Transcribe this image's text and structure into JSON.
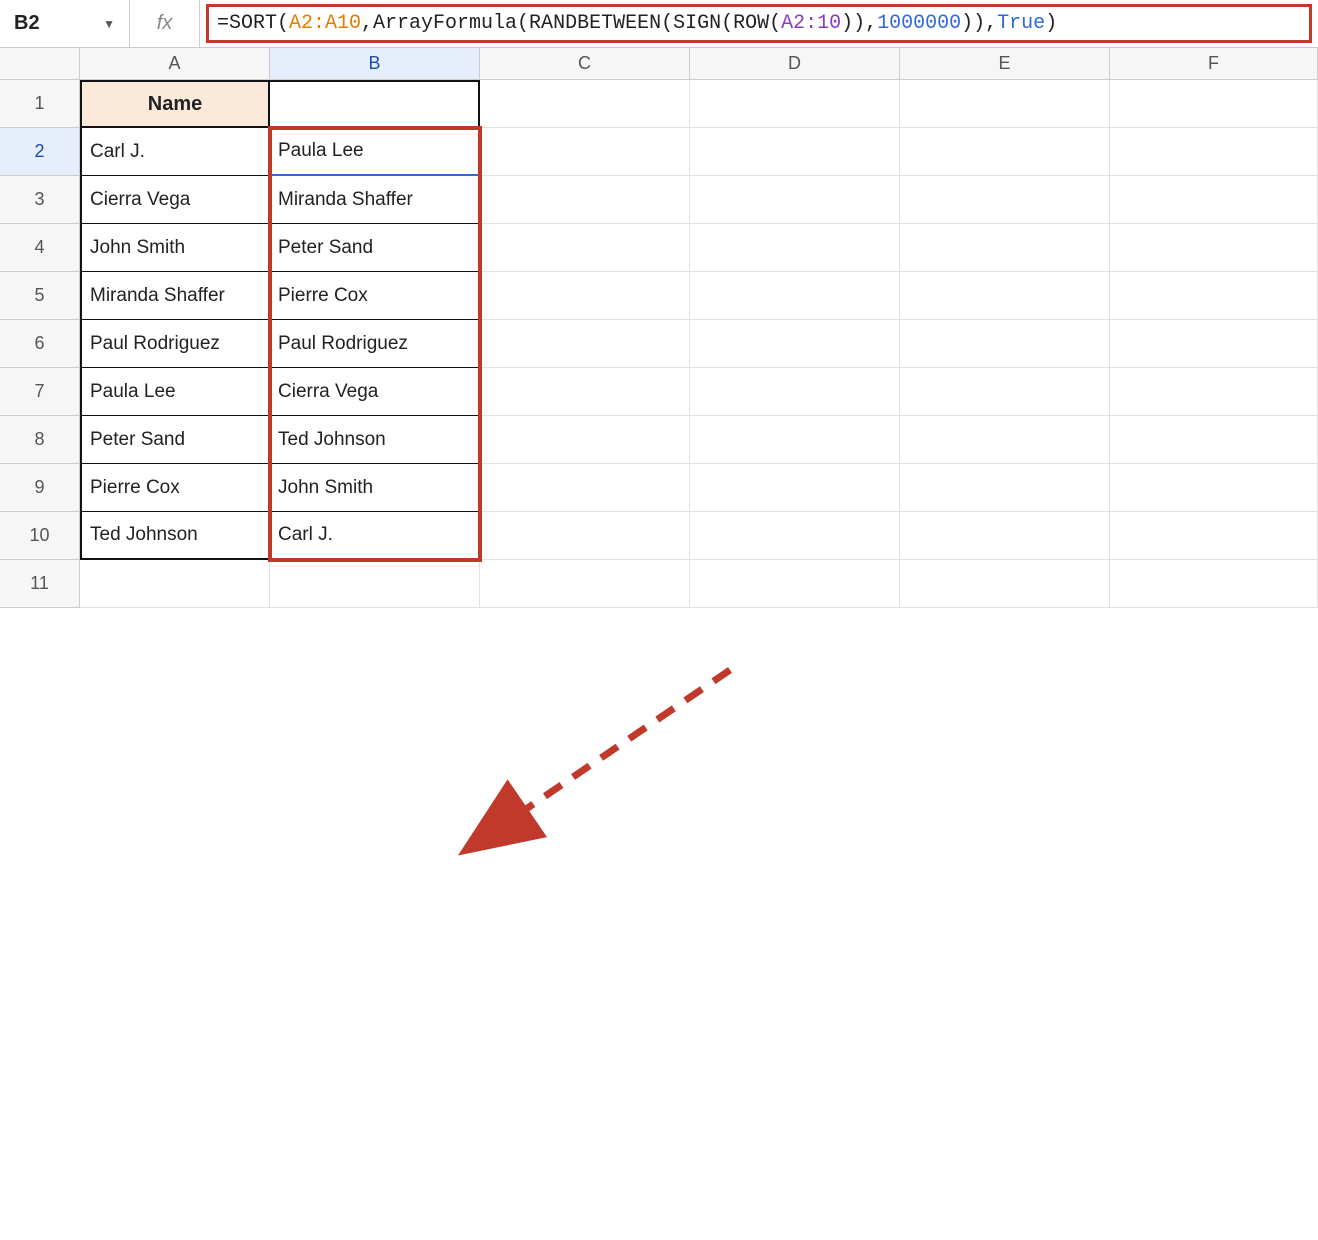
{
  "nameBox": {
    "cellRef": "B2"
  },
  "fxLabel": "fx",
  "formula": {
    "parts": [
      {
        "cls": "tok-black",
        "text": "=SORT("
      },
      {
        "cls": "tok-orange",
        "text": "A2:A10"
      },
      {
        "cls": "tok-black",
        "text": ",ArrayFormula(RANDBETWEEN(SIGN(ROW("
      },
      {
        "cls": "tok-purple",
        "text": "A2:10"
      },
      {
        "cls": "tok-black",
        "text": ")),"
      },
      {
        "cls": "tok-blue",
        "text": "1000000"
      },
      {
        "cls": "tok-black",
        "text": ")),"
      },
      {
        "cls": "tok-truefalse",
        "text": "True"
      },
      {
        "cls": "tok-black",
        "text": ")"
      }
    ]
  },
  "columns": [
    "A",
    "B",
    "C",
    "D",
    "E",
    "F"
  ],
  "activeColumn": "B",
  "activeRow": 2,
  "rowCount": 11,
  "header": {
    "A1": "Name"
  },
  "colA": [
    "Carl J.",
    "Cierra Vega",
    "John Smith",
    "Miranda Shaffer",
    "Paul Rodriguez",
    "Paula Lee",
    "Peter Sand",
    "Pierre Cox",
    "Ted Johnson"
  ],
  "colB": [
    "Paula Lee",
    "Miranda Shaffer",
    "Peter Sand",
    "Pierre Cox",
    "Paul Rodriguez",
    "Cierra Vega",
    "Ted Johnson",
    "John Smith",
    "Carl J."
  ]
}
